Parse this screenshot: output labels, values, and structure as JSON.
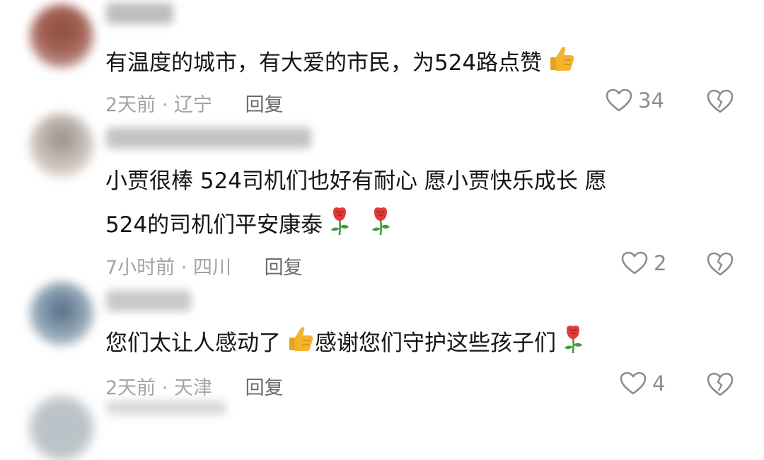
{
  "comments": [
    {
      "text_lines": [
        "有温度的城市，有大爱的市民，为524路点赞"
      ],
      "time": "2天前",
      "location": "辽宁",
      "reply_label": "回复",
      "likes": "34",
      "emojis": [
        "thumbs-up"
      ]
    },
    {
      "text_lines": [
        "小贾很棒   524司机们也好有耐心   愿小贾快乐成长  愿",
        "524的司机们平安康泰"
      ],
      "time": "7小时前",
      "location": "四川",
      "reply_label": "回复",
      "likes": "2",
      "emojis": [
        "rose",
        "rose"
      ]
    },
    {
      "text_lines": [
        "您们太让人感动了",
        "感谢您们守护这些孩子们"
      ],
      "time": "2天前",
      "location": "天津",
      "reply_label": "回复",
      "likes": "4",
      "emojis": [
        "thumbs-up",
        "rose"
      ]
    }
  ],
  "colors": {
    "text": "#141414",
    "meta": "#a3a3a3",
    "reply": "#6c6c6c",
    "icon": "#8d8d8d",
    "thumb": "#f4b32b",
    "rose": "#e23a3a",
    "stem": "#3f9a3a"
  },
  "icons": {
    "like": "heart-outline-icon",
    "dislike": "broken-heart-icon",
    "emoji_thumb": "thumbs-up-emoji-icon",
    "emoji_rose": "rose-emoji-icon"
  }
}
